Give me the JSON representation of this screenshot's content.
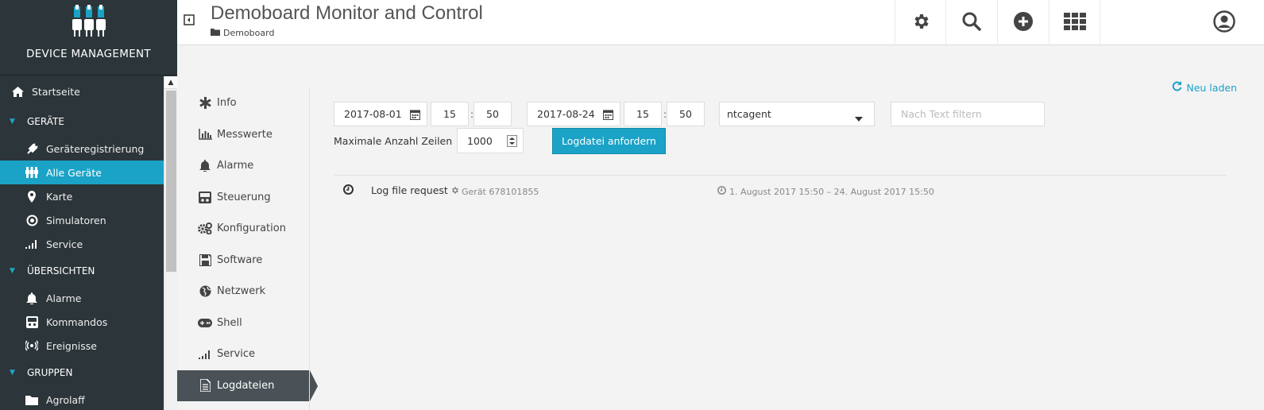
{
  "sidebar": {
    "brand": "DEVICE MANAGEMENT",
    "home": "Startseite",
    "sections": [
      {
        "title": "GERÄTE",
        "items": [
          "Geräteregistrierung",
          "Alle Geräte",
          "Karte",
          "Simulatoren",
          "Service"
        ]
      },
      {
        "title": "ÜBERSICHTEN",
        "items": [
          "Alarme",
          "Kommandos",
          "Ereignisse"
        ]
      },
      {
        "title": "GRUPPEN",
        "items": [
          "Agrolaff"
        ]
      }
    ],
    "active_item": "Alle Geräte",
    "accent": "#1aa3c7",
    "background": "#2c3539"
  },
  "header": {
    "title": "Demoboard Monitor and Control",
    "breadcrumb": "Demoboard",
    "buttons": [
      "gear-icon",
      "search-icon",
      "plus-circle-icon",
      "apps-grid-icon",
      "user-icon"
    ]
  },
  "tabs": {
    "items": [
      "Info",
      "Messwerte",
      "Alarme",
      "Steuerung",
      "Konfiguration",
      "Software",
      "Netzwerk",
      "Shell",
      "Service",
      "Logdateien"
    ],
    "active": "Logdateien"
  },
  "logs": {
    "reload_label": "Neu laden",
    "from_date": "2017-08-01",
    "from_hour": "15",
    "from_minute": "50",
    "to_date": "2017-08-24",
    "to_hour": "15",
    "to_minute": "50",
    "time_separator": ":",
    "log_type": "ntcagent",
    "filter_placeholder": "Nach Text filtern",
    "max_rows_label": "Maximale Anzahl Zeilen",
    "max_rows_value": "1000",
    "request_button": "Logdatei anfordern",
    "entries": [
      {
        "name": "Log file request",
        "device": "Gerät 678101855",
        "range": "1. August 2017 15:50 – 24. August 2017 15:50"
      }
    ]
  }
}
